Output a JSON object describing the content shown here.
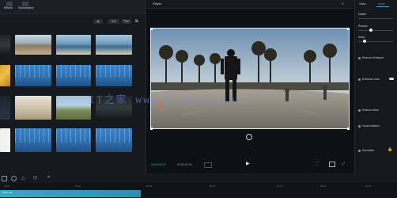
{
  "left_panel": {
    "tabs": [
      {
        "label": "Effects"
      },
      {
        "label": "Subscription"
      }
    ],
    "sort_label": "Sort",
    "filter_label": "Filter"
  },
  "player": {
    "title": "Player",
    "timecode_current": "00:00:00:00",
    "timecode_total": "00:00:07:00",
    "play_icon": "play-icon"
  },
  "right_panel": {
    "tabs": [
      {
        "label": "Video"
      },
      {
        "label": "Audio"
      }
    ],
    "rows": [
      {
        "label": "Master"
      },
      {
        "label": "Reduce"
      },
      {
        "label": "Noise"
      }
    ],
    "sections": [
      {
        "label": "Remove Enhance"
      },
      {
        "label": "Enhance voice"
      },
      {
        "label": "Reduce noise"
      },
      {
        "label": "Vocal isolation"
      },
      {
        "label": "Normalize"
      }
    ]
  },
  "timeline": {
    "ruler": [
      "00:00",
      "00:03",
      "00:06",
      "00:09",
      "00:12",
      "00:15",
      "00:18"
    ],
    "clip_label": "Video clip"
  },
  "watermark": "IT之家 www.ithome.com",
  "colors": {
    "accent": "#3aa7c9",
    "selection": "#e6e9ee"
  }
}
